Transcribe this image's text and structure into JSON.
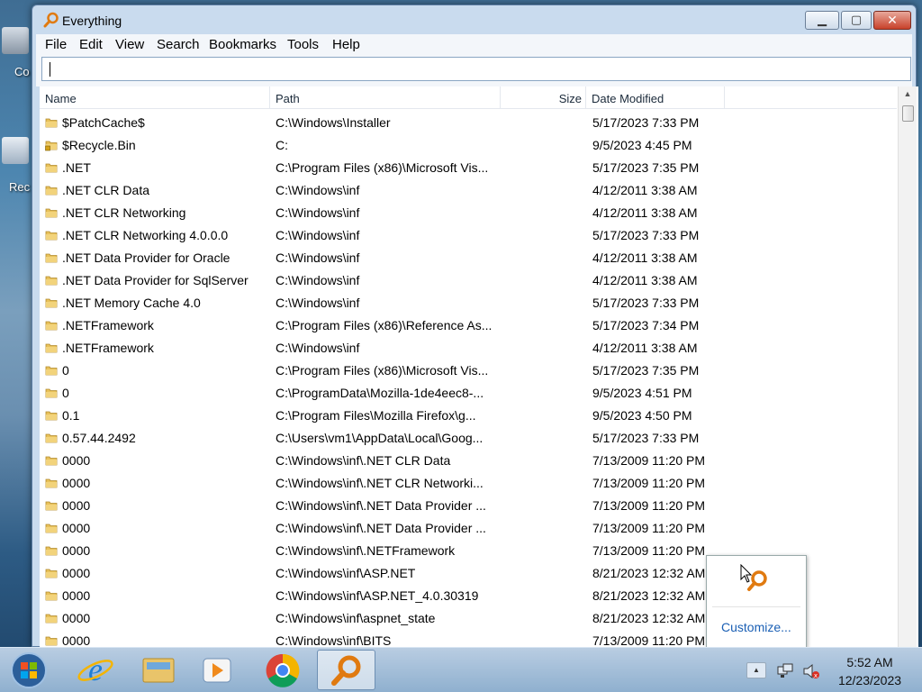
{
  "desktop": {
    "icons": [
      {
        "label": "Co",
        "icon": "computer-icon"
      },
      {
        "label": "Rec",
        "icon": "recycle-bin-icon"
      }
    ]
  },
  "window": {
    "title": "Everything",
    "controls": {
      "minimize": "minimize-icon",
      "maximize": "maximize-icon",
      "close": "close-icon"
    }
  },
  "menu": [
    "File",
    "Edit",
    "View",
    "Search",
    "Bookmarks",
    "Tools",
    "Help"
  ],
  "search": {
    "value": "",
    "placeholder": ""
  },
  "columns": [
    "Name",
    "Path",
    "Size",
    "Date Modified"
  ],
  "rows": [
    {
      "name": "$PatchCache$",
      "path": "C:\\Windows\\Installer",
      "size": "",
      "date": "5/17/2023 7:33 PM",
      "icon": "folder-icon"
    },
    {
      "name": "$Recycle.Bin",
      "path": "C:",
      "size": "",
      "date": "9/5/2023 4:45 PM",
      "icon": "locked-folder-icon"
    },
    {
      "name": ".NET",
      "path": "C:\\Program Files (x86)\\Microsoft Vis...",
      "size": "",
      "date": "5/17/2023 7:35 PM",
      "icon": "folder-icon"
    },
    {
      "name": ".NET CLR Data",
      "path": "C:\\Windows\\inf",
      "size": "",
      "date": "4/12/2011 3:38 AM",
      "icon": "folder-icon"
    },
    {
      "name": ".NET CLR Networking",
      "path": "C:\\Windows\\inf",
      "size": "",
      "date": "4/12/2011 3:38 AM",
      "icon": "folder-icon"
    },
    {
      "name": ".NET CLR Networking 4.0.0.0",
      "path": "C:\\Windows\\inf",
      "size": "",
      "date": "5/17/2023 7:33 PM",
      "icon": "folder-icon"
    },
    {
      "name": ".NET Data Provider for Oracle",
      "path": "C:\\Windows\\inf",
      "size": "",
      "date": "4/12/2011 3:38 AM",
      "icon": "folder-icon"
    },
    {
      "name": ".NET Data Provider for SqlServer",
      "path": "C:\\Windows\\inf",
      "size": "",
      "date": "4/12/2011 3:38 AM",
      "icon": "folder-icon"
    },
    {
      "name": ".NET Memory Cache 4.0",
      "path": "C:\\Windows\\inf",
      "size": "",
      "date": "5/17/2023 7:33 PM",
      "icon": "folder-icon"
    },
    {
      "name": ".NETFramework",
      "path": "C:\\Program Files (x86)\\Reference As...",
      "size": "",
      "date": "5/17/2023 7:34 PM",
      "icon": "folder-icon"
    },
    {
      "name": ".NETFramework",
      "path": "C:\\Windows\\inf",
      "size": "",
      "date": "4/12/2011 3:38 AM",
      "icon": "folder-icon"
    },
    {
      "name": "0",
      "path": "C:\\Program Files (x86)\\Microsoft Vis...",
      "size": "",
      "date": "5/17/2023 7:35 PM",
      "icon": "folder-icon"
    },
    {
      "name": "0",
      "path": "C:\\ProgramData\\Mozilla-1de4eec8-...",
      "size": "",
      "date": "9/5/2023 4:51 PM",
      "icon": "folder-icon"
    },
    {
      "name": "0.1",
      "path": "C:\\Program Files\\Mozilla Firefox\\g...",
      "size": "",
      "date": "9/5/2023 4:50 PM",
      "icon": "folder-icon"
    },
    {
      "name": "0.57.44.2492",
      "path": "C:\\Users\\vm1\\AppData\\Local\\Goog...",
      "size": "",
      "date": "5/17/2023 7:33 PM",
      "icon": "folder-icon"
    },
    {
      "name": "0000",
      "path": "C:\\Windows\\inf\\.NET CLR Data",
      "size": "",
      "date": "7/13/2009 11:20 PM",
      "icon": "folder-icon"
    },
    {
      "name": "0000",
      "path": "C:\\Windows\\inf\\.NET CLR Networki...",
      "size": "",
      "date": "7/13/2009 11:20 PM",
      "icon": "folder-icon"
    },
    {
      "name": "0000",
      "path": "C:\\Windows\\inf\\.NET Data Provider ...",
      "size": "",
      "date": "7/13/2009 11:20 PM",
      "icon": "folder-icon"
    },
    {
      "name": "0000",
      "path": "C:\\Windows\\inf\\.NET Data Provider ...",
      "size": "",
      "date": "7/13/2009 11:20 PM",
      "icon": "folder-icon"
    },
    {
      "name": "0000",
      "path": "C:\\Windows\\inf\\.NETFramework",
      "size": "",
      "date": "7/13/2009 11:20 PM",
      "icon": "folder-icon"
    },
    {
      "name": "0000",
      "path": "C:\\Windows\\inf\\ASP.NET",
      "size": "",
      "date": "8/21/2023 12:32 AM",
      "icon": "folder-icon"
    },
    {
      "name": "0000",
      "path": "C:\\Windows\\inf\\ASP.NET_4.0.30319",
      "size": "",
      "date": "8/21/2023 12:32 AM",
      "icon": "folder-icon"
    },
    {
      "name": "0000",
      "path": "C:\\Windows\\inf\\aspnet_state",
      "size": "",
      "date": "8/21/2023 12:32 AM",
      "icon": "folder-icon"
    },
    {
      "name": "0000",
      "path": "C:\\Windows\\inf\\BITS",
      "size": "",
      "date": "7/13/2009 11:20 PM",
      "icon": "folder-icon"
    }
  ],
  "popup": {
    "link": "Customize...",
    "icon": "everything-app-icon"
  },
  "taskbar": {
    "apps": [
      {
        "name": "internet-explorer",
        "icon": "internet-explorer-icon"
      },
      {
        "name": "file-explorer",
        "icon": "folder-library-icon"
      },
      {
        "name": "media-player",
        "icon": "media-player-icon"
      },
      {
        "name": "chrome",
        "icon": "chrome-icon"
      },
      {
        "name": "everything",
        "icon": "everything-app-icon"
      }
    ],
    "clock_time": "5:52 AM",
    "clock_date": "12/23/2023"
  },
  "colors": {
    "accent": "#1a5fb4",
    "folder": "#e8c15a",
    "titlebar": "#c9dbee"
  }
}
